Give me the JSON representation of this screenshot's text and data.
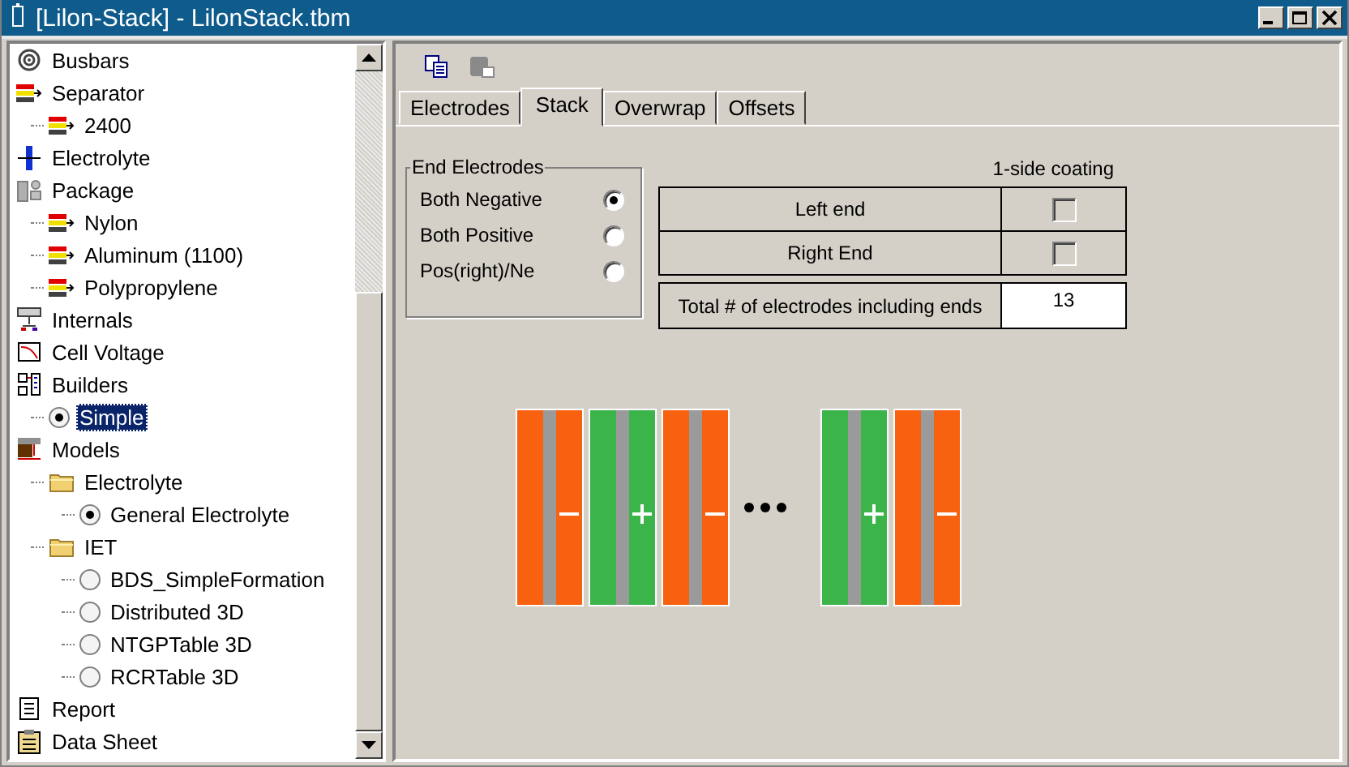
{
  "window": {
    "title": "[Lilon-Stack] - LilonStack.tbm"
  },
  "tree": [
    {
      "label": "Busbars",
      "kind": "busbar"
    },
    {
      "label": "Separator",
      "kind": "layer",
      "children": [
        {
          "label": "2400",
          "kind": "layer"
        }
      ]
    },
    {
      "label": "Electrolyte",
      "kind": "electrolyte"
    },
    {
      "label": "Package",
      "kind": "package",
      "children": [
        {
          "label": "Nylon",
          "kind": "layer"
        },
        {
          "label": "Aluminum (1100)",
          "kind": "layer"
        },
        {
          "label": "Polypropylene",
          "kind": "layer"
        }
      ]
    },
    {
      "label": "Internals",
      "kind": "internals"
    },
    {
      "label": "Cell Voltage",
      "kind": "chart"
    },
    {
      "label": "Builders",
      "kind": "builder",
      "children": [
        {
          "label": "Simple",
          "kind": "radio",
          "checked": true,
          "selected": true
        }
      ]
    },
    {
      "label": "Models",
      "kind": "model",
      "children": [
        {
          "label": "Electrolyte",
          "kind": "folder",
          "children": [
            {
              "label": "General Electrolyte",
              "kind": "radio",
              "checked": true,
              "selected": false
            }
          ]
        },
        {
          "label": "IET",
          "kind": "folder",
          "children": [
            {
              "label": "BDS_SimpleFormation",
              "kind": "radio",
              "checked": false,
              "selected": false
            },
            {
              "label": "Distributed 3D",
              "kind": "radio",
              "checked": false,
              "selected": false
            },
            {
              "label": "NTGPTable 3D",
              "kind": "radio",
              "checked": false,
              "selected": false
            },
            {
              "label": "RCRTable 3D",
              "kind": "radio",
              "checked": false,
              "selected": false
            }
          ]
        }
      ]
    },
    {
      "label": "Report",
      "kind": "report"
    },
    {
      "label": "Data Sheet",
      "kind": "sheet"
    }
  ],
  "toolbar": [
    {
      "kind": "copy",
      "disabled": false
    },
    {
      "kind": "paste",
      "disabled": true
    }
  ],
  "tabs": [
    {
      "label": "Electrodes",
      "selected": false
    },
    {
      "label": "Stack",
      "selected": true
    },
    {
      "label": "Overwrap",
      "selected": false
    },
    {
      "label": "Offsets",
      "selected": false
    }
  ],
  "end_electrodes": {
    "title": "End Electrodes",
    "options": [
      {
        "label": "Both Negative",
        "selected": true
      },
      {
        "label": "Both Positive",
        "selected": false
      },
      {
        "label": "Pos(right)/Ne",
        "selected": false
      }
    ]
  },
  "coating": {
    "heading": "1-side coating",
    "rows": [
      {
        "label": "Left end",
        "checked": false
      },
      {
        "label": "Right End",
        "checked": false
      }
    ]
  },
  "total": {
    "label": "Total # of electrodes including ends",
    "value": "13"
  },
  "stack_diagram": [
    {
      "kind": "negative"
    },
    {
      "kind": "positive"
    },
    {
      "kind": "negative"
    },
    {
      "kind": "ellipsis"
    },
    {
      "kind": "positive"
    },
    {
      "kind": "negative"
    }
  ]
}
